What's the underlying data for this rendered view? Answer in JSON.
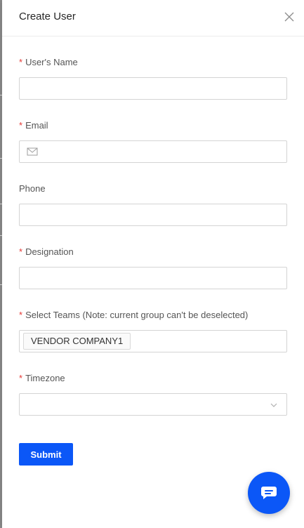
{
  "drawer": {
    "title": "Create User"
  },
  "form": {
    "name_label": "User's Name",
    "email_label": "Email",
    "phone_label": "Phone",
    "designation_label": "Designation",
    "teams_label": "Select Teams (Note: current group can't be deselected)",
    "timezone_label": "Timezone",
    "required_marker": "*",
    "selected_team": "VENDOR COMPANY1"
  },
  "actions": {
    "submit_label": "Submit"
  },
  "icons": {
    "close": "close-icon",
    "mail": "mail-icon",
    "chevron": "chevron-down-icon",
    "chat": "chat-icon"
  },
  "colors": {
    "accent": "#0b57f7",
    "required": "#e53935"
  }
}
